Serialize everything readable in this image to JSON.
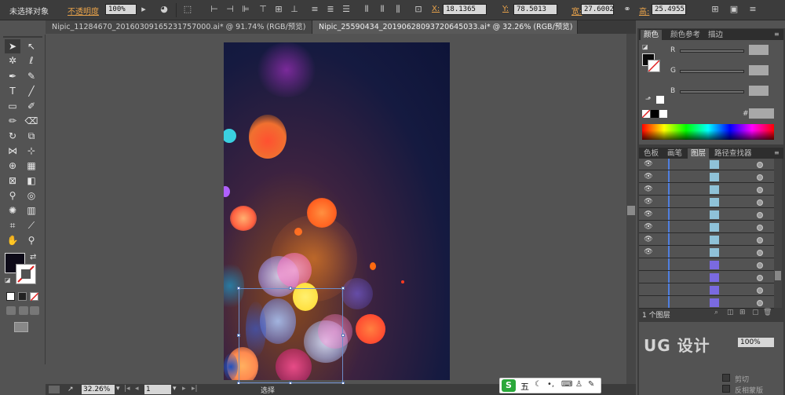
{
  "control_bar": {
    "selection_status": "未选择对象",
    "opacity_label": "不透明度",
    "opacity_value": "100%",
    "x_label": "X:",
    "x_value": "18.1365",
    "y_label": "Y:",
    "y_value": "78.5013",
    "width_label": "宽:",
    "width_value": "27.6002",
    "height_label": "高:",
    "height_value": "25.4955"
  },
  "document_tabs": [
    {
      "title": "Nipic_11284670_20160309165231757000.ai* @ 91.74% (RGB/预览)",
      "active": false
    },
    {
      "title": "Nipic_25590434_20190628093720645033.ai* @ 32.26% (RGB/预览)",
      "active": true
    }
  ],
  "color_panel": {
    "tabs": [
      "颜色",
      "颜色参考",
      "描边"
    ],
    "active_tab": "颜色",
    "channel_r": "R",
    "channel_g": "G",
    "channel_b": "B",
    "hex_label": "#"
  },
  "layers_panel": {
    "tabs": [
      "色板",
      "画笔",
      "图层",
      "路径查找器"
    ],
    "active_tab": "图层",
    "layer_count": "1 个图层"
  },
  "transparency_panel": {
    "opacity_value": "100%",
    "clip_label": "剪切",
    "invert_mask_label": "反相蒙版"
  },
  "status_bar": {
    "zoom": "32.26%",
    "page": "1",
    "tool_name": "选择"
  },
  "ime": {
    "mode": "五"
  },
  "watermark": "UG 设计"
}
